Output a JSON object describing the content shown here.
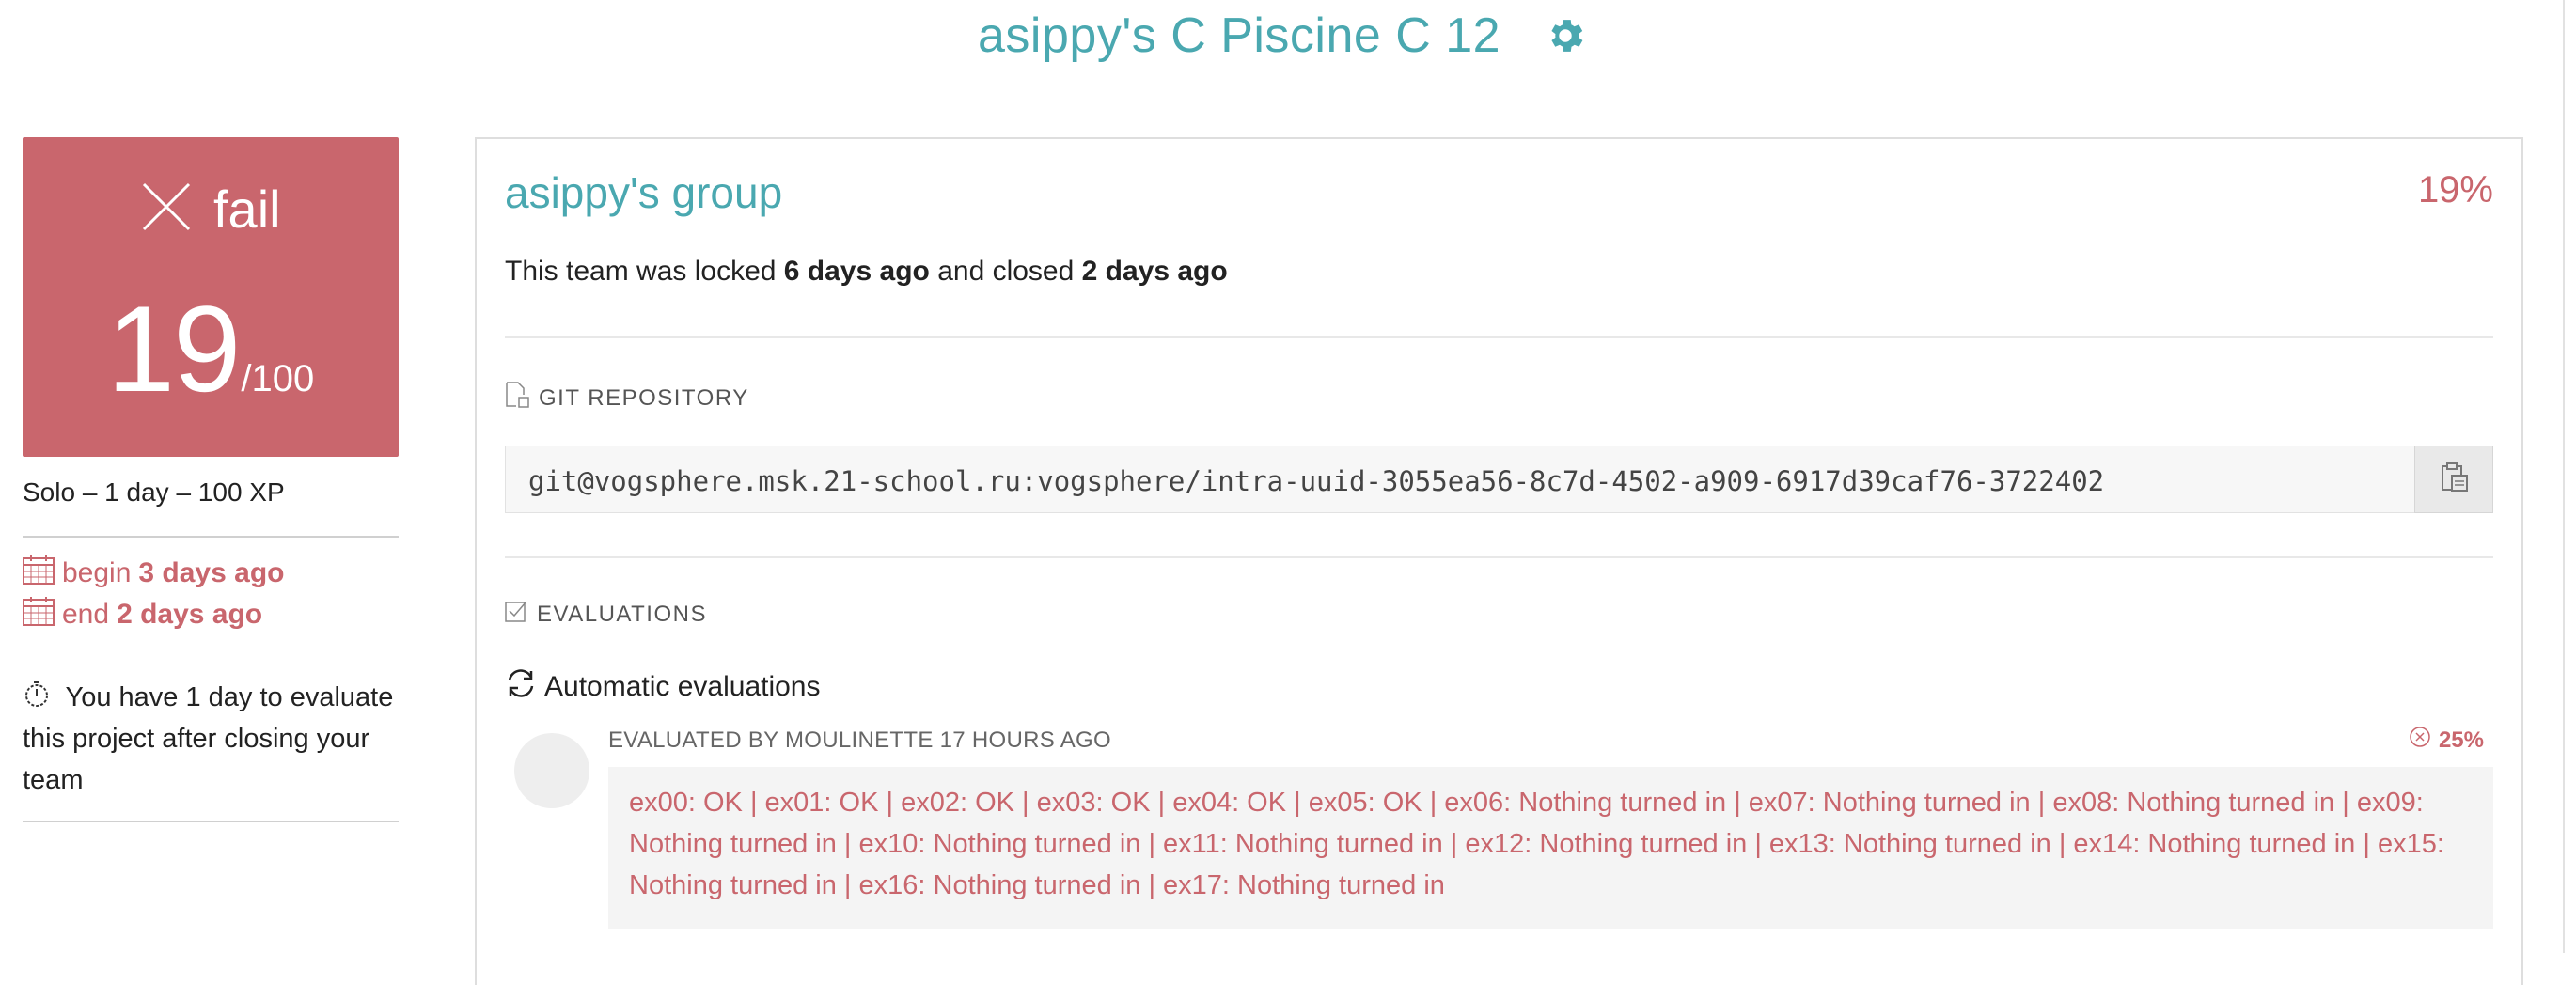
{
  "header": {
    "title": "asippy's C Piscine C 12",
    "settings_icon": "gear-icon",
    "accent_color": "#4aa8b0"
  },
  "status_card": {
    "status_icon": "close-icon",
    "status": "fail",
    "score": "19",
    "max_score": "/100",
    "color": "#c9666d"
  },
  "project_meta": "Solo – 1 day – 100 XP",
  "dates": {
    "begin_label": "begin",
    "begin_value": "3 days ago",
    "end_label": "end",
    "end_value": "2 days ago"
  },
  "evaluation_note": "You have 1 day to evaluate this project after closing your team",
  "group": {
    "title": "asippy's group",
    "percent": "19%",
    "status_prefix": "This team was locked ",
    "locked_value": "6 days ago",
    "status_middle": " and closed ",
    "closed_value": "2 days ago"
  },
  "repository": {
    "label": "GIT REPOSITORY",
    "url": "git@vogsphere.msk.21-school.ru:vogsphere/intra-uuid-3055ea56-8c7d-4502-a909-6917d39caf76-3722402",
    "copy_icon": "clipboard-icon"
  },
  "evaluations": {
    "label": "EVALUATIONS",
    "automatic_label": "Automatic evaluations",
    "evaluator_line": "EVALUATED BY MOULINETTE 17 HOURS AGO",
    "score": "25%",
    "result_text": "ex00: OK | ex01: OK | ex02: OK | ex03: OK | ex04: OK | ex05: OK | ex06: Nothing turned in | ex07: Nothing turned in | ex08: Nothing turned in | ex09: Nothing turned in | ex10: Nothing turned in | ex11: Nothing turned in | ex12: Nothing turned in | ex13: Nothing turned in | ex14: Nothing turned in | ex15: Nothing turned in | ex16: Nothing turned in | ex17: Nothing turned in"
  }
}
